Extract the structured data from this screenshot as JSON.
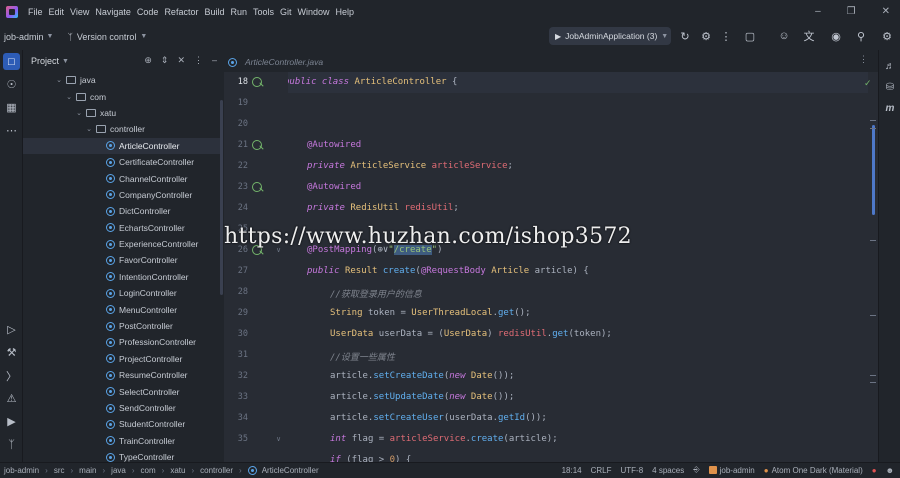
{
  "menu": [
    "File",
    "Edit",
    "View",
    "Navigate",
    "Code",
    "Refactor",
    "Build",
    "Run",
    "Tools",
    "Git",
    "Window",
    "Help"
  ],
  "toolbar": {
    "project_name": "job-admin",
    "version_control": "Version control",
    "run_config": "JobAdminApplication (3)"
  },
  "project_panel": {
    "title": "Project",
    "tree": [
      {
        "label": "java",
        "kind": "folder",
        "depth": 0
      },
      {
        "label": "com",
        "kind": "folder",
        "depth": 1
      },
      {
        "label": "xatu",
        "kind": "folder",
        "depth": 2
      },
      {
        "label": "controller",
        "kind": "folder",
        "depth": 3
      },
      {
        "label": "ArticleController",
        "kind": "class",
        "depth": 4,
        "selected": true
      },
      {
        "label": "CertificateController",
        "kind": "class",
        "depth": 4
      },
      {
        "label": "ChannelController",
        "kind": "class",
        "depth": 4
      },
      {
        "label": "CompanyController",
        "kind": "class",
        "depth": 4
      },
      {
        "label": "DictController",
        "kind": "class",
        "depth": 4
      },
      {
        "label": "EchartsController",
        "kind": "class",
        "depth": 4
      },
      {
        "label": "ExperienceController",
        "kind": "class",
        "depth": 4
      },
      {
        "label": "FavorController",
        "kind": "class",
        "depth": 4
      },
      {
        "label": "IntentionController",
        "kind": "class",
        "depth": 4
      },
      {
        "label": "LoginController",
        "kind": "class",
        "depth": 4
      },
      {
        "label": "MenuController",
        "kind": "class",
        "depth": 4
      },
      {
        "label": "PostController",
        "kind": "class",
        "depth": 4
      },
      {
        "label": "ProfessionController",
        "kind": "class",
        "depth": 4
      },
      {
        "label": "ProjectController",
        "kind": "class",
        "depth": 4
      },
      {
        "label": "ResumeController",
        "kind": "class",
        "depth": 4
      },
      {
        "label": "SelectController",
        "kind": "class",
        "depth": 4
      },
      {
        "label": "SendController",
        "kind": "class",
        "depth": 4
      },
      {
        "label": "StudentController",
        "kind": "class",
        "depth": 4
      },
      {
        "label": "TrainController",
        "kind": "class",
        "depth": 4
      },
      {
        "label": "TypeController",
        "kind": "class",
        "depth": 4
      }
    ]
  },
  "editor": {
    "tab_label": "ArticleController.java",
    "line_numbers": [
      "18",
      "19",
      "20",
      "21",
      "22",
      "23",
      "24",
      "25",
      "26",
      "27",
      "28",
      "29",
      "30",
      "31",
      "32",
      "33",
      "34",
      "35"
    ],
    "current_line": "18"
  },
  "watermark": "https://www.huzhan.com/ishop3572",
  "statusbar": {
    "breadcrumb": [
      "job-admin",
      "src",
      "main",
      "java",
      "com",
      "xatu",
      "controller",
      "ArticleController"
    ],
    "position": "18:14",
    "line_sep": "CRLF",
    "encoding": "UTF-8",
    "indent": "4 spaces",
    "module": "job-admin",
    "theme": "Atom One Dark (Material)"
  },
  "colors": {
    "keyword": "#c678dd",
    "type": "#e5c07b",
    "function": "#61afef",
    "string": "#98c379",
    "number": "#d19a66",
    "field": "#e06c75",
    "comment": "#7f848e",
    "accent": "#2d5cb6"
  }
}
